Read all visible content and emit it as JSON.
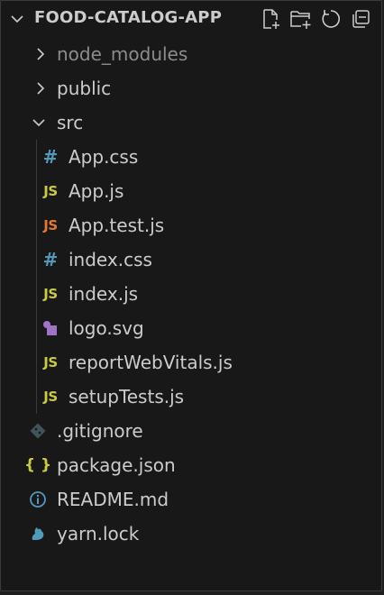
{
  "explorer": {
    "title": "FOOD-CATALOG-APP",
    "actions": [
      {
        "name": "new-file-icon"
      },
      {
        "name": "new-folder-icon"
      },
      {
        "name": "refresh-icon"
      },
      {
        "name": "collapse-all-icon"
      }
    ]
  },
  "tree": {
    "node_modules": "node_modules",
    "public": "public",
    "src": "src",
    "src_files": [
      {
        "label": "App.css",
        "type": "css",
        "glyph": "#"
      },
      {
        "label": "App.js",
        "type": "js",
        "glyph": "JS"
      },
      {
        "label": "App.test.js",
        "type": "test-js",
        "glyph": "JS"
      },
      {
        "label": "index.css",
        "type": "css",
        "glyph": "#"
      },
      {
        "label": "index.js",
        "type": "js",
        "glyph": "JS"
      },
      {
        "label": "logo.svg",
        "type": "svg",
        "glyph": ""
      },
      {
        "label": "reportWebVitals.js",
        "type": "js",
        "glyph": "JS"
      },
      {
        "label": "setupTests.js",
        "type": "js",
        "glyph": "JS"
      }
    ],
    "root_files": [
      {
        "label": ".gitignore",
        "type": "git",
        "glyph": ""
      },
      {
        "label": "package.json",
        "type": "json",
        "glyph": "{ }"
      },
      {
        "label": "README.md",
        "type": "info",
        "glyph": "ⓘ"
      },
      {
        "label": "yarn.lock",
        "type": "yarn",
        "glyph": ""
      }
    ]
  },
  "colors": {
    "background": "#181818",
    "text": "#cccccc",
    "dimmed": "#8c8c8c",
    "js": "#cbcb41",
    "test_js": "#e37933",
    "css": "#519aba",
    "svg": "#a074c4",
    "json": "#cbcb41",
    "info": "#519aba",
    "git": "#41535b",
    "yarn": "#519aba"
  }
}
